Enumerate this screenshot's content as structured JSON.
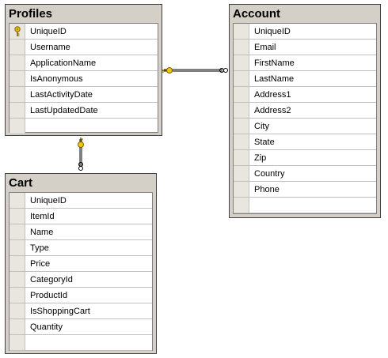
{
  "tables": {
    "profiles": {
      "title": "Profiles",
      "columns": [
        "UniqueID",
        "Username",
        "ApplicationName",
        "IsAnonymous",
        "LastActivityDate",
        "LastUpdatedDate"
      ]
    },
    "account": {
      "title": "Account",
      "columns": [
        "UniqueID",
        "Email",
        "FirstName",
        "LastName",
        "Address1",
        "Address2",
        "City",
        "State",
        "Zip",
        "Country",
        "Phone"
      ]
    },
    "cart": {
      "title": "Cart",
      "columns": [
        "UniqueID",
        "ItemId",
        "Name",
        "Type",
        "Price",
        "CategoryId",
        "ProductId",
        "IsShoppingCart",
        "Quantity"
      ]
    }
  },
  "icons": {
    "primary_key": "key-icon",
    "relationship_one_end": "key-icon",
    "relationship_many_end": "infinity-icon"
  },
  "colors": {
    "table_chrome": "#d4d0c8",
    "key_icon": "#f0c800",
    "relationship_line": "#000000"
  }
}
